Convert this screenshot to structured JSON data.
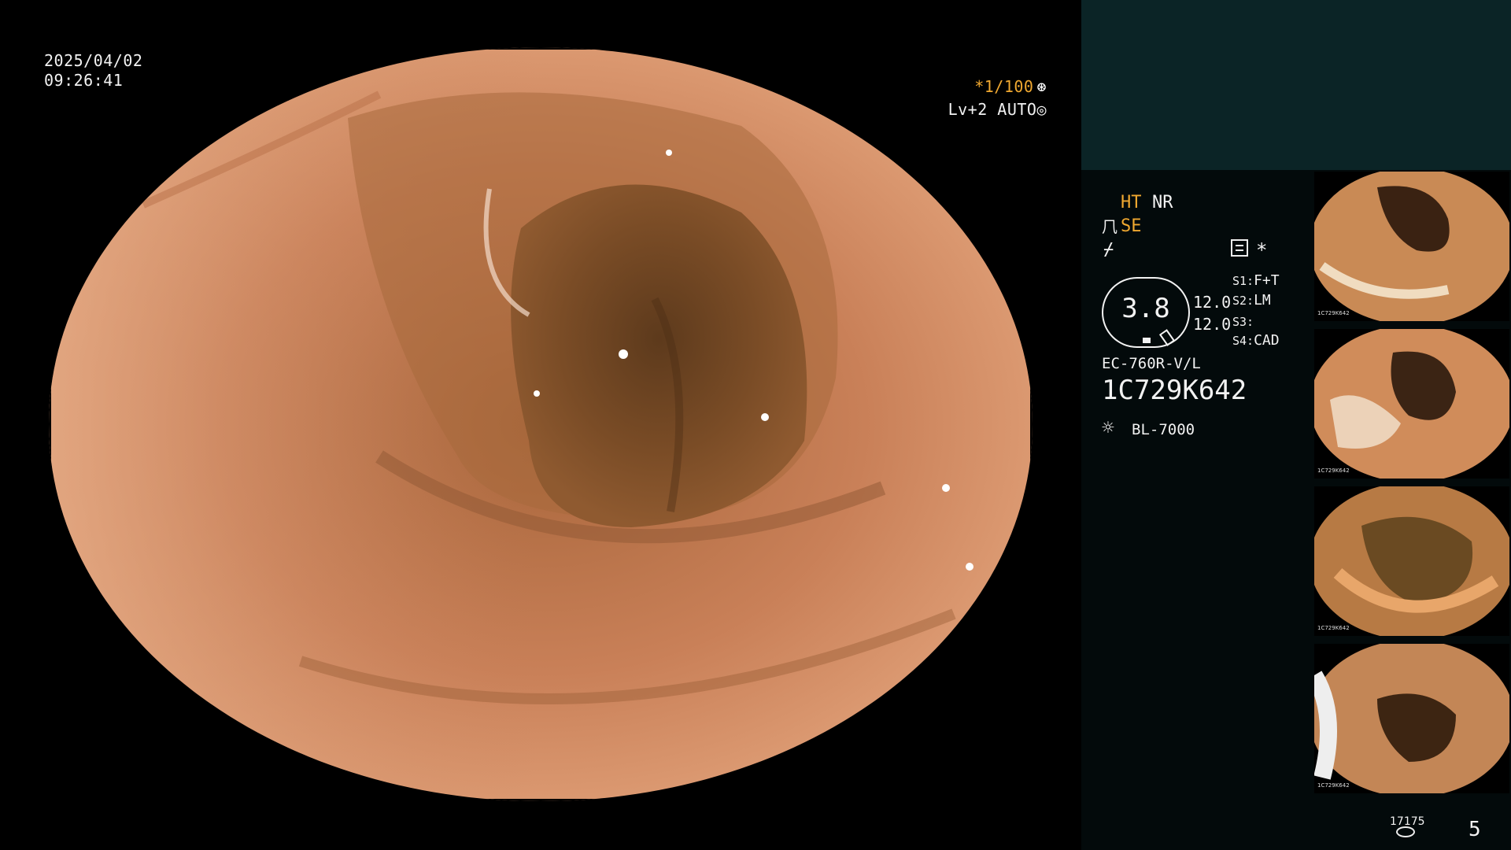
{
  "overlay": {
    "date": "2025/04/02",
    "time": "09:26:41",
    "shutter": "*1/100",
    "shutter_icon": "⊛",
    "level": "Lv+2 AUTO",
    "level_icon": "◎"
  },
  "panel": {
    "mode_ht": "HT",
    "mode_nr": "NR",
    "se_icon": "⺇",
    "mode_se": "SE",
    "flag_icon": "⌿",
    "star_icon": "*",
    "dial_value": "3.8",
    "value_1": "12.0",
    "value_2": "12.0",
    "slots": [
      {
        "key": "S1:",
        "value": "F+T"
      },
      {
        "key": "S2:",
        "value": "LM"
      },
      {
        "key": "S3:",
        "value": ""
      },
      {
        "key": "S4:",
        "value": "CAD"
      }
    ],
    "scope_model": "EC-760R-V/L",
    "serial_number": "1C729K642",
    "light_icon": "☼",
    "light_source": "BL-7000",
    "frame_counter": "17175",
    "page_number": "5",
    "thumb_caption": "1C729K642"
  },
  "colors": {
    "accent_orange": "#f0a830",
    "panel_teal": "#0b2426",
    "panel_dark": "#030a0b"
  }
}
